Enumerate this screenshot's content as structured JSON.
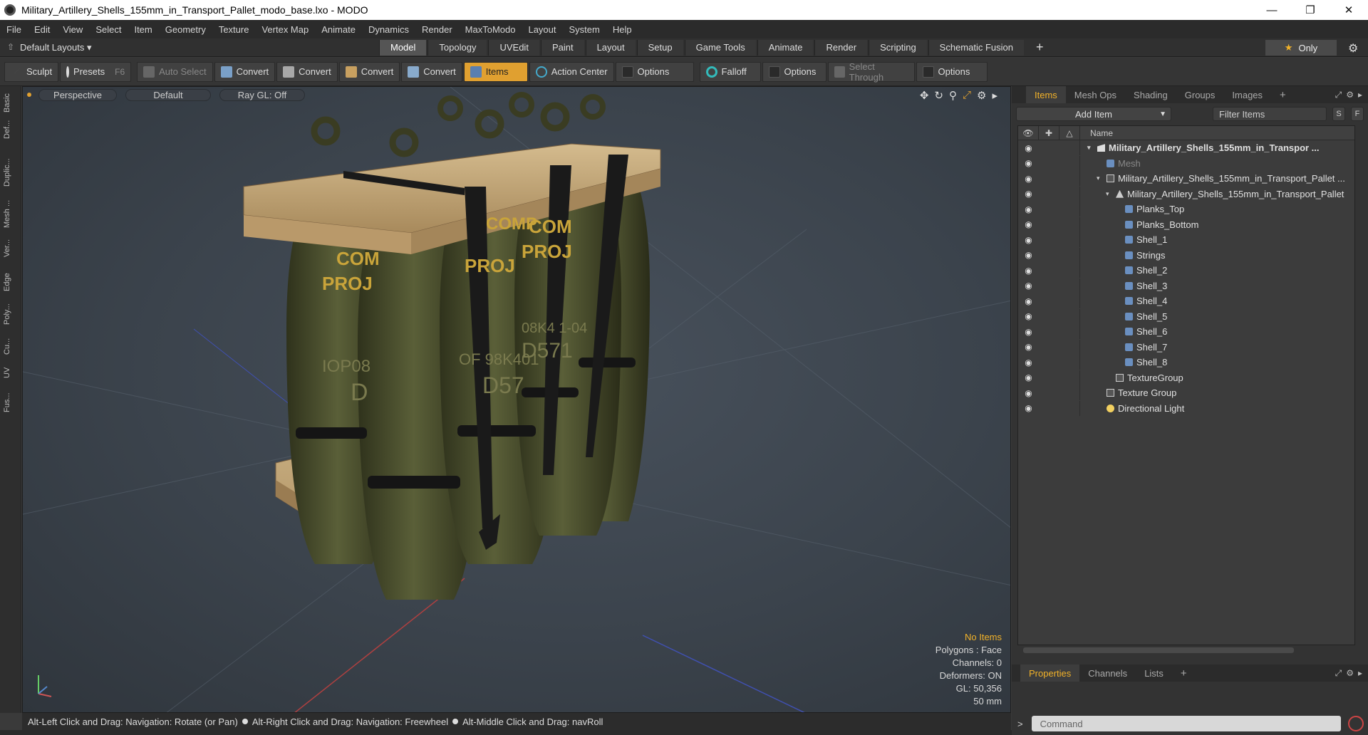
{
  "window": {
    "title": "Military_Artillery_Shells_155mm_in_Transport_Pallet_modo_base.lxo - MODO",
    "min": "—",
    "max": "❐",
    "close": "✕"
  },
  "menu": [
    "File",
    "Edit",
    "View",
    "Select",
    "Item",
    "Geometry",
    "Texture",
    "Vertex Map",
    "Animate",
    "Dynamics",
    "Render",
    "MaxToModo",
    "Layout",
    "System",
    "Help"
  ],
  "layouts": {
    "dropdown": "Default Layouts ▾",
    "tabs": [
      "Model",
      "Topology",
      "UVEdit",
      "Paint",
      "Layout",
      "Setup",
      "Game Tools",
      "Animate",
      "Render",
      "Scripting",
      "Schematic Fusion"
    ],
    "active_tab": "Model",
    "plus": "+",
    "only": "Only"
  },
  "toolbar": {
    "sculpt": "Sculpt",
    "presets": "Presets",
    "presets_key": "F6",
    "auto_select": "Auto Select",
    "convert1": "Convert",
    "convert2": "Convert",
    "convert3": "Convert",
    "convert4": "Convert",
    "items": "Items",
    "action_center": "Action Center",
    "options1": "Options",
    "falloff": "Falloff",
    "options2": "Options",
    "select_through": "Select Through",
    "options3": "Options"
  },
  "left_tabs": [
    "Basic",
    "Def...",
    "Duplic...",
    "Mesh ...",
    "Ver...",
    "Edge",
    "Poly...",
    "Cu...",
    "UV",
    "Fus..."
  ],
  "viewport": {
    "view": "Perspective",
    "shading": "Default",
    "raygl": "Ray GL: Off",
    "stats": {
      "selection": "No Items",
      "polygons": "Polygons : Face",
      "channels": "Channels: 0",
      "deformers": "Deformers: ON",
      "gl": "GL: 50,356",
      "scale": "50 mm"
    },
    "label_text": {
      "shell1a": "COM",
      "shell1b": "PROJ",
      "shell1c": "IOP08",
      "shell1d": "D",
      "shell2a": "COMP",
      "shell2b": "PROJ",
      "shell2c": "OF 98K401",
      "shell2d": "D57",
      "shell3a": "COM",
      "shell3b": "PROJ",
      "shell3c": "08K4 1-04",
      "shell3d": "D571"
    }
  },
  "statusbar": {
    "hint1": "Alt-Left Click and Drag: Navigation: Rotate (or Pan)",
    "hint2": "Alt-Right Click and Drag: Navigation: Freewheel",
    "hint3": "Alt-Middle Click and Drag: navRoll"
  },
  "items_panel": {
    "tabs": [
      "Items",
      "Mesh Ops",
      "Shading",
      "Groups",
      "Images"
    ],
    "active_tab": "Items",
    "plus": "+",
    "add_item": "Add Item",
    "filter": "Filter Items",
    "s_btn": "S",
    "f_btn": "F",
    "col_name": "Name",
    "rows": [
      {
        "label": "Military_Artillery_Shells_155mm_in_Transpor ...",
        "indent": 0,
        "tri": "▾",
        "type": "scene",
        "bold": true
      },
      {
        "label": "Mesh",
        "indent": 1,
        "tri": "",
        "type": "mesh",
        "dim": true
      },
      {
        "label": "Military_Artillery_Shells_155mm_in_Transport_Pallet ...",
        "indent": 1,
        "tri": "▾",
        "type": "group"
      },
      {
        "label": "Military_Artillery_Shells_155mm_in_Transport_Pallet",
        "indent": 2,
        "tri": "▾",
        "type": "locator"
      },
      {
        "label": "Planks_Top",
        "indent": 3,
        "tri": "",
        "type": "mesh"
      },
      {
        "label": "Planks_Bottom",
        "indent": 3,
        "tri": "",
        "type": "mesh"
      },
      {
        "label": "Shell_1",
        "indent": 3,
        "tri": "",
        "type": "mesh"
      },
      {
        "label": "Strings",
        "indent": 3,
        "tri": "",
        "type": "mesh"
      },
      {
        "label": "Shell_2",
        "indent": 3,
        "tri": "",
        "type": "mesh"
      },
      {
        "label": "Shell_3",
        "indent": 3,
        "tri": "",
        "type": "mesh"
      },
      {
        "label": "Shell_4",
        "indent": 3,
        "tri": "",
        "type": "mesh"
      },
      {
        "label": "Shell_5",
        "indent": 3,
        "tri": "",
        "type": "mesh"
      },
      {
        "label": "Shell_6",
        "indent": 3,
        "tri": "",
        "type": "mesh"
      },
      {
        "label": "Shell_7",
        "indent": 3,
        "tri": "",
        "type": "mesh"
      },
      {
        "label": "Shell_8",
        "indent": 3,
        "tri": "",
        "type": "mesh"
      },
      {
        "label": "TextureGroup",
        "indent": 2,
        "tri": "",
        "type": "group"
      },
      {
        "label": "Texture Group",
        "indent": 1,
        "tri": "",
        "type": "group"
      },
      {
        "label": "Directional Light",
        "indent": 1,
        "tri": "",
        "type": "light"
      }
    ]
  },
  "properties_panel": {
    "tabs": [
      "Properties",
      "Channels",
      "Lists"
    ],
    "active_tab": "Properties",
    "plus": "+",
    "command_placeholder": "Command",
    "prompt": ">"
  },
  "colors": {
    "accent": "#f2b229",
    "shell": "#4a4e30",
    "wood": "#b89a6c",
    "strap": "#1a1a1a"
  }
}
